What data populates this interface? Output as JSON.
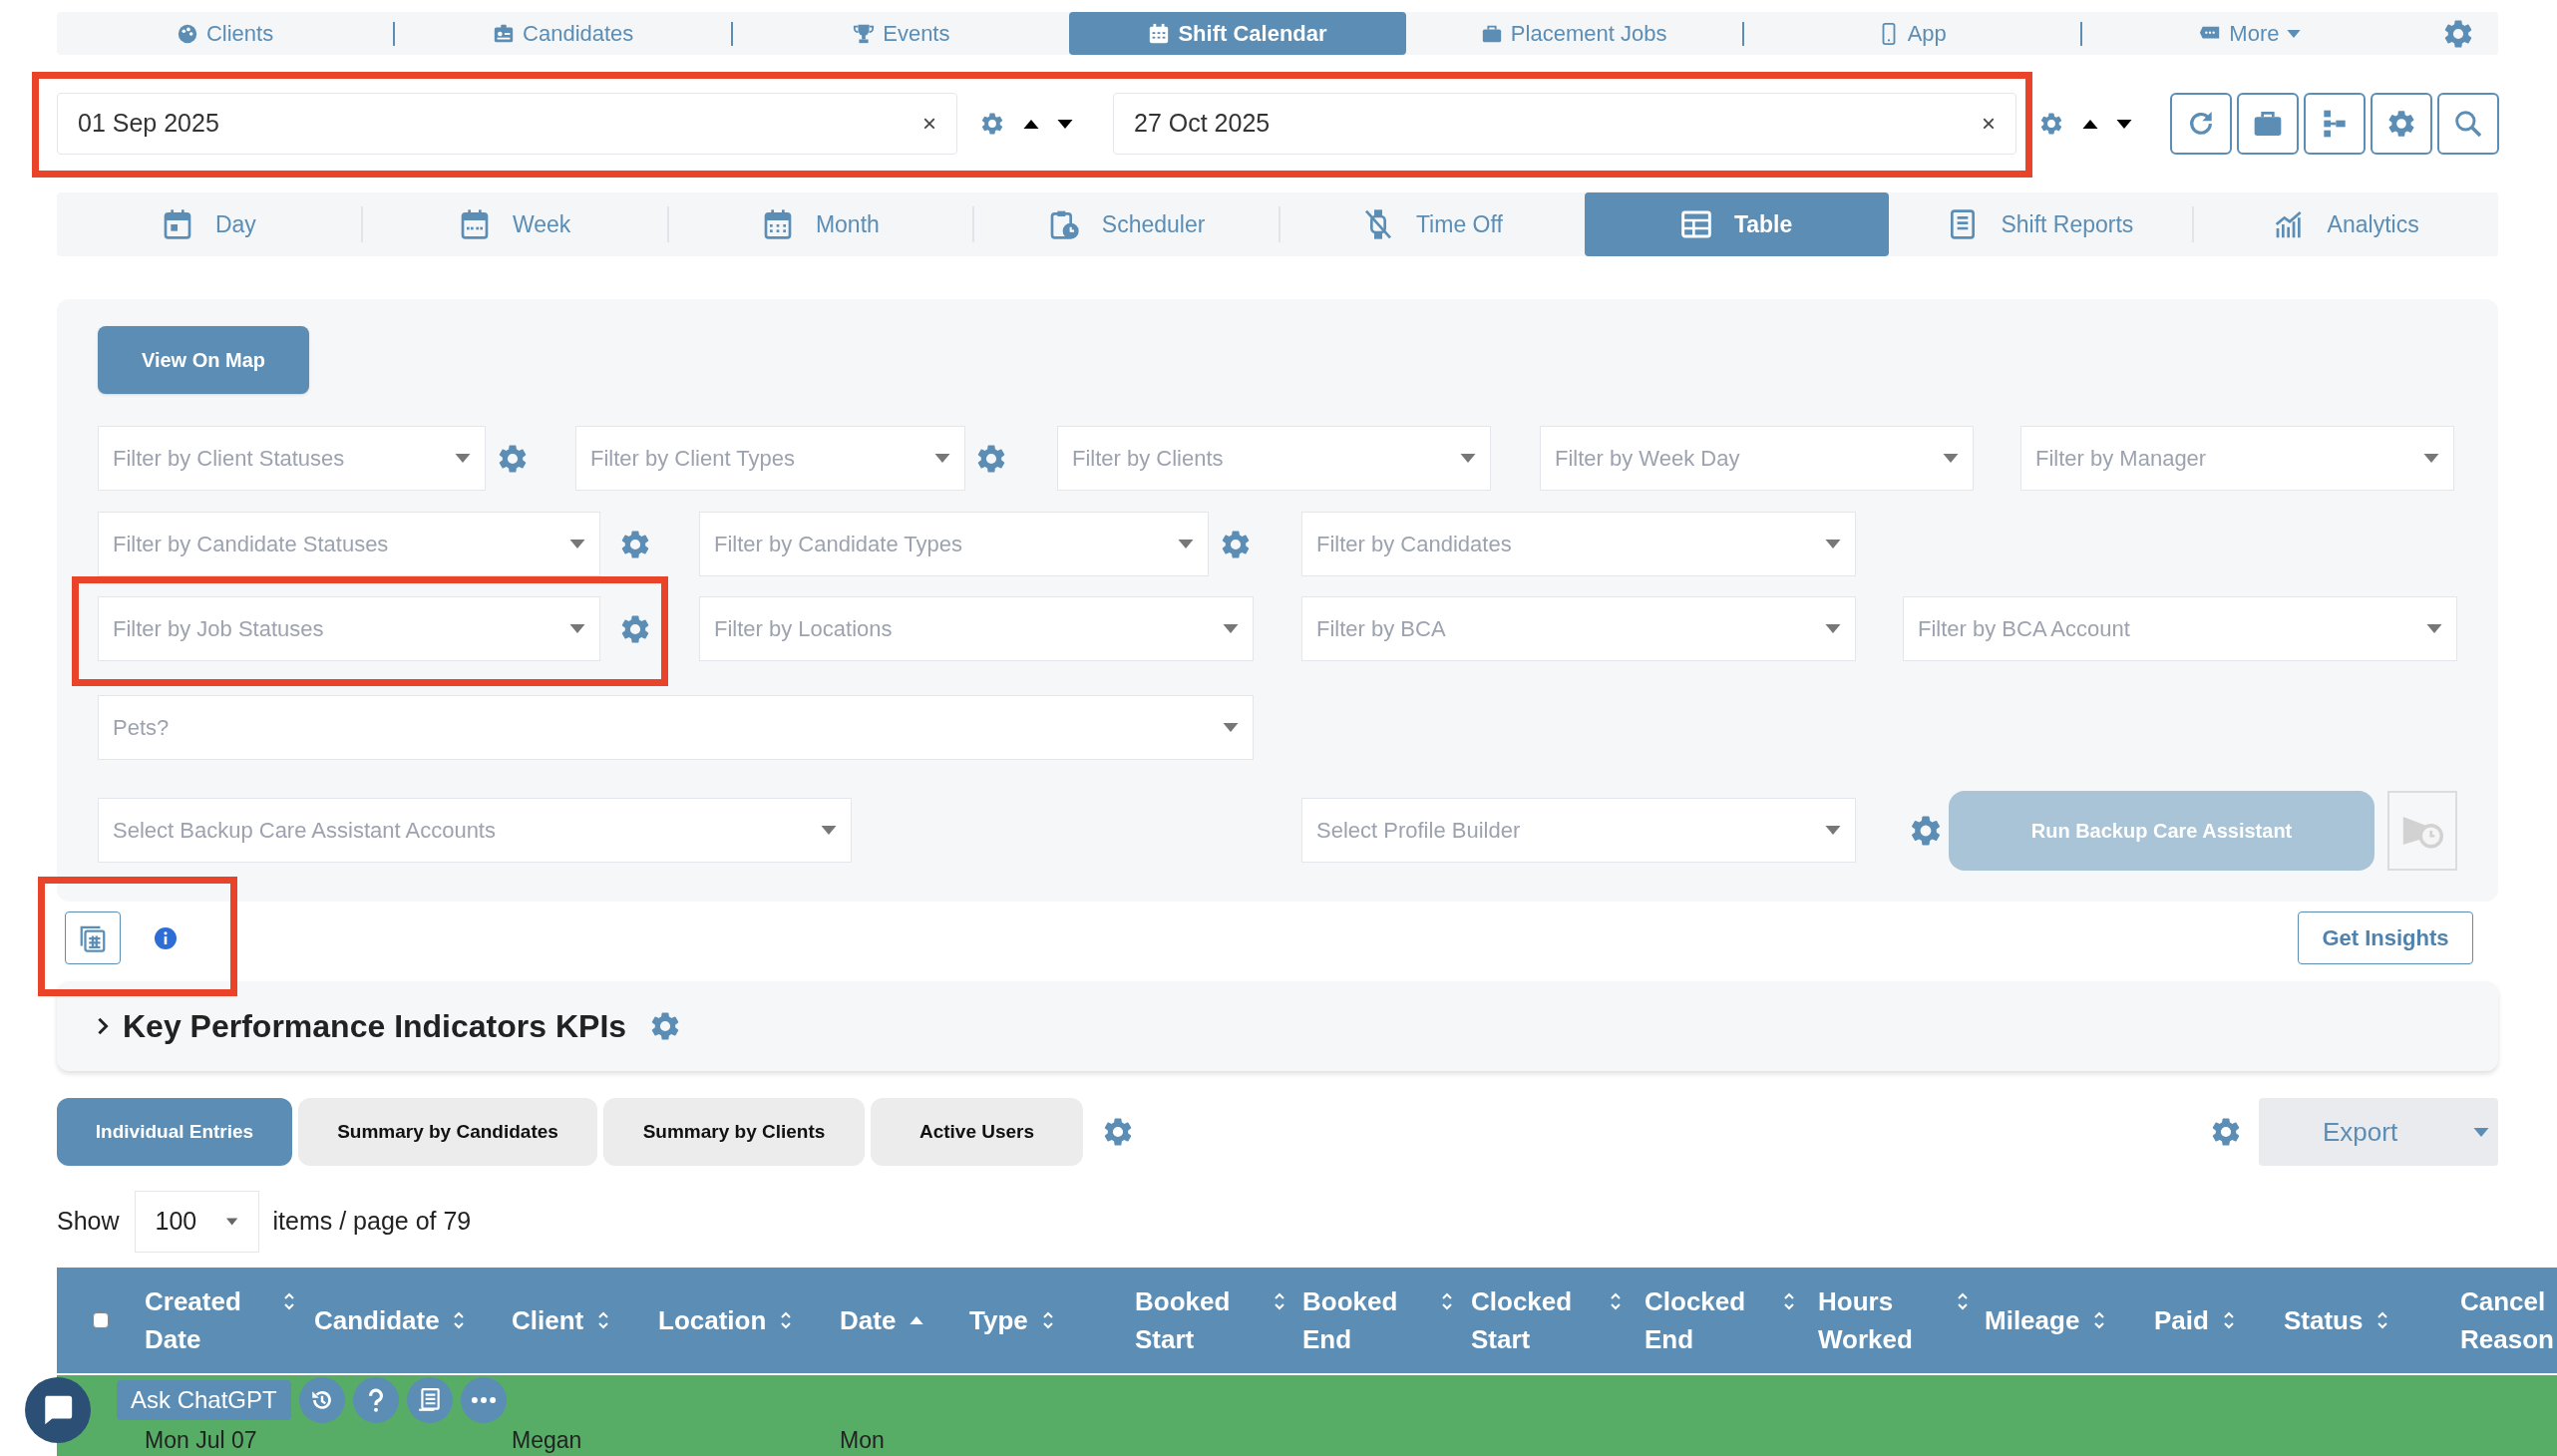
{
  "top_nav": {
    "items": [
      {
        "label": "Clients",
        "selected": false,
        "dropdown": false
      },
      {
        "label": "Candidates",
        "selected": false,
        "dropdown": false
      },
      {
        "label": "Events",
        "selected": false,
        "dropdown": false
      },
      {
        "label": "Shift Calendar",
        "selected": true,
        "dropdown": false
      },
      {
        "label": "Placement Jobs",
        "selected": false,
        "dropdown": false
      },
      {
        "label": "App",
        "selected": false,
        "dropdown": false
      },
      {
        "label": "More",
        "selected": false,
        "dropdown": true
      }
    ]
  },
  "date_range": {
    "highlighted": true,
    "fields": [
      {
        "value": "01 Sep 2025",
        "clear": "×"
      },
      {
        "value": "27 Oct 2025",
        "clear": "×"
      }
    ]
  },
  "view_tabs": [
    {
      "label": "Day",
      "selected": false
    },
    {
      "label": "Week",
      "selected": false
    },
    {
      "label": "Month",
      "selected": false
    },
    {
      "label": "Scheduler",
      "selected": false
    },
    {
      "label": "Time Off",
      "selected": false
    },
    {
      "label": "Table",
      "selected": true
    },
    {
      "label": "Shift Reports",
      "selected": false
    },
    {
      "label": "Analytics",
      "selected": false
    }
  ],
  "filters": {
    "view_on_map": "View On Map",
    "items": [
      {
        "placeholder": "Filter by Client Statuses",
        "gear": true,
        "highlighted": false
      },
      {
        "placeholder": "Filter by Client Types",
        "gear": true,
        "highlighted": false
      },
      {
        "placeholder": "Filter by Clients",
        "gear": false,
        "highlighted": false
      },
      {
        "placeholder": "Filter by Week Day",
        "gear": false,
        "highlighted": false
      },
      {
        "placeholder": "Filter by Manager",
        "gear": false,
        "highlighted": false
      },
      {
        "placeholder": "Filter by Candidate Statuses",
        "gear": true,
        "highlighted": false
      },
      {
        "placeholder": "Filter by Candidate Types",
        "gear": true,
        "highlighted": false
      },
      {
        "placeholder": "Filter by Candidates",
        "gear": false,
        "highlighted": false
      },
      {
        "placeholder": "Filter by Job Statuses",
        "gear": true,
        "highlighted": true
      },
      {
        "placeholder": "Filter by Locations",
        "gear": false,
        "highlighted": false
      },
      {
        "placeholder": "Filter by BCA",
        "gear": false,
        "highlighted": false
      },
      {
        "placeholder": "Filter by BCA Account",
        "gear": false,
        "highlighted": false
      },
      {
        "placeholder": "Pets?",
        "gear": false,
        "highlighted": false
      },
      {
        "placeholder": "Select Backup Care Assistant Accounts",
        "gear": false,
        "highlighted": false
      },
      {
        "placeholder": "Select Profile Builder",
        "gear": false,
        "highlighted": false
      }
    ],
    "backup_button": {
      "label": "Run Backup Care Assistant",
      "disabled": true
    },
    "schedule_button": {
      "disabled": true
    }
  },
  "tools": {
    "highlighted": true
  },
  "get_insights": "Get Insights",
  "kpi": {
    "title": "Key Performance Indicators KPIs",
    "expanded": false
  },
  "report_tabs": [
    {
      "label": "Individual Entries",
      "selected": true
    },
    {
      "label": "Summary by Candidates",
      "selected": false
    },
    {
      "label": "Summary by Clients",
      "selected": false
    },
    {
      "label": "Active Users",
      "selected": false
    }
  ],
  "export": "Export",
  "pagination": {
    "show": "Show",
    "page_size": "100",
    "suffix": "items / page of 79"
  },
  "table": {
    "select_all": {
      "checked": false
    },
    "columns": [
      {
        "label": "Created Date",
        "sorted_ascending": false
      },
      {
        "label": "Candidate",
        "sorted_ascending": false
      },
      {
        "label": "Client",
        "sorted_ascending": false
      },
      {
        "label": "Location",
        "sorted_ascending": false
      },
      {
        "label": "Date",
        "sorted_ascending": true
      },
      {
        "label": "Type",
        "sorted_ascending": false
      },
      {
        "label": "Booked Start",
        "sorted_ascending": false
      },
      {
        "label": "Booked End",
        "sorted_ascending": false
      },
      {
        "label": "Clocked Start",
        "sorted_ascending": false
      },
      {
        "label": "Clocked End",
        "sorted_ascending": false
      },
      {
        "label": "Hours Worked",
        "sorted_ascending": false
      },
      {
        "label": "Mileage",
        "sorted_ascending": false
      },
      {
        "label": "Paid",
        "sorted_ascending": false
      },
      {
        "label": "Status",
        "sorted_ascending": false
      },
      {
        "label": "Cancel Reason"
      }
    ],
    "rows": [
      {
        "color": "#57ad66",
        "created_date": "Mon Jul 07",
        "client": "Megan",
        "date": "Mon"
      }
    ]
  },
  "chat_widget": {
    "label": "Ask ChatGPT"
  }
}
